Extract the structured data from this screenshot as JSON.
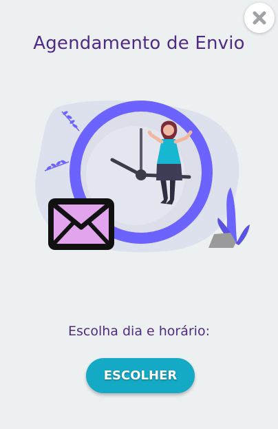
{
  "modal": {
    "title": "Agendamento de Envio",
    "prompt": "Escolha dia e horário:",
    "choose_button_label": "ESCOLHER",
    "close_icon": "close-icon"
  },
  "illustration": {
    "description_icons": [
      "clock-icon",
      "envelope-icon",
      "woman-figure",
      "leaf-branch-icon",
      "plant-icon",
      "rock-icon"
    ]
  },
  "colors": {
    "background": "#edf0f1",
    "title": "#4f2a86",
    "button": "#14a9c5",
    "clock_ring": "#6c63ff",
    "envelope_fill": "#e2a4ec"
  }
}
